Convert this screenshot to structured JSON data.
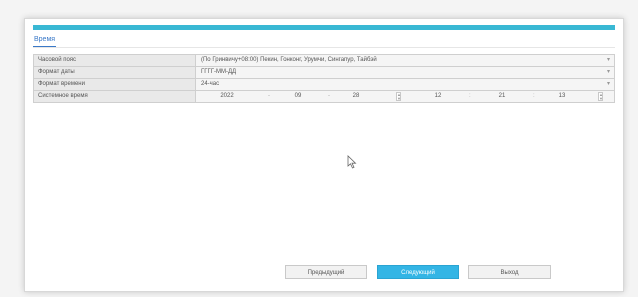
{
  "header": {
    "title": ""
  },
  "tabs": [
    {
      "label": "Время"
    }
  ],
  "settings": {
    "timezone": {
      "label": "Часовой пояс",
      "value": "(По Гринвичу+08:00) Пекин, Гонконг, Урумчи, Сингапур, Тайбэй"
    },
    "date_format": {
      "label": "Формат даты",
      "value": "ГГГГ-ММ-ДД"
    },
    "time_format": {
      "label": "Формат времени",
      "value": "24-час"
    },
    "system_time": {
      "label": "Системное время",
      "year": "2022",
      "month": "09",
      "day": "28",
      "hour": "12",
      "minute": "21",
      "second": "13",
      "date_sep": "-",
      "time_sep": ":"
    }
  },
  "buttons": {
    "prev": "Предыдущий",
    "next": "Следующий",
    "exit": "Выход"
  },
  "colors": {
    "accent": "#39b8d4",
    "primary_button": "#33b5e5",
    "tab_active": "#3a79c8"
  },
  "icons": {
    "dropdown": "chevron-down-icon",
    "spinner": "spinner-arrows-icon",
    "cursor": "mouse-pointer-icon"
  }
}
